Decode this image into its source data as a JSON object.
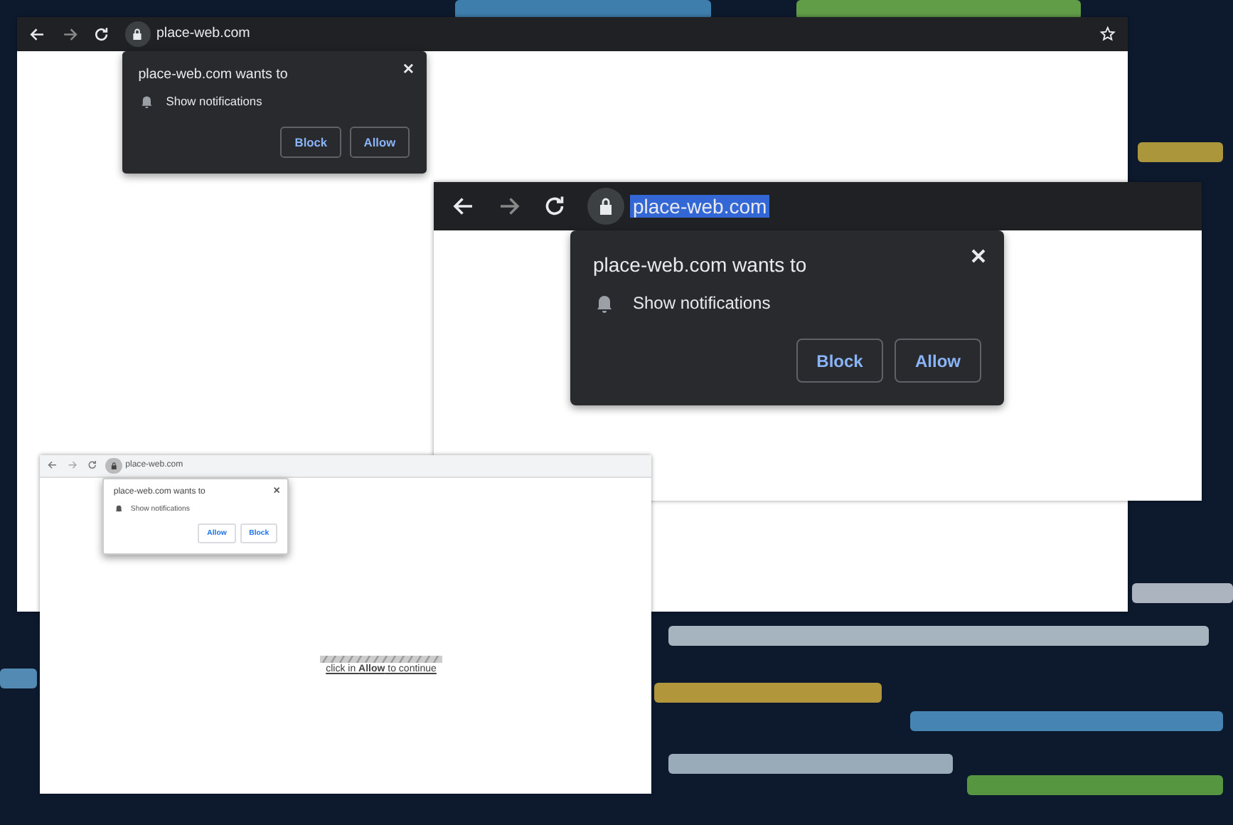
{
  "windows": [
    {
      "kind": "dark",
      "url": "place-web.com",
      "url_selected": false,
      "bookmark_star": true,
      "prompt": {
        "title": "place-web.com wants to",
        "permission": "Show notifications",
        "buttons": [
          "Block",
          "Allow"
        ]
      }
    },
    {
      "kind": "dark",
      "url": "place-web.com",
      "url_selected": true,
      "bookmark_star": false,
      "prompt": {
        "title": "place-web.com wants to",
        "permission": "Show notifications",
        "buttons": [
          "Block",
          "Allow"
        ]
      }
    },
    {
      "kind": "light",
      "url": "place-web.com",
      "url_selected": false,
      "bookmark_star": false,
      "prompt": {
        "title": "place-web.com wants to",
        "permission": "Show notifications",
        "buttons": [
          "Allow",
          "Block"
        ]
      },
      "page_message": "click in **Allow** to continue"
    }
  ]
}
